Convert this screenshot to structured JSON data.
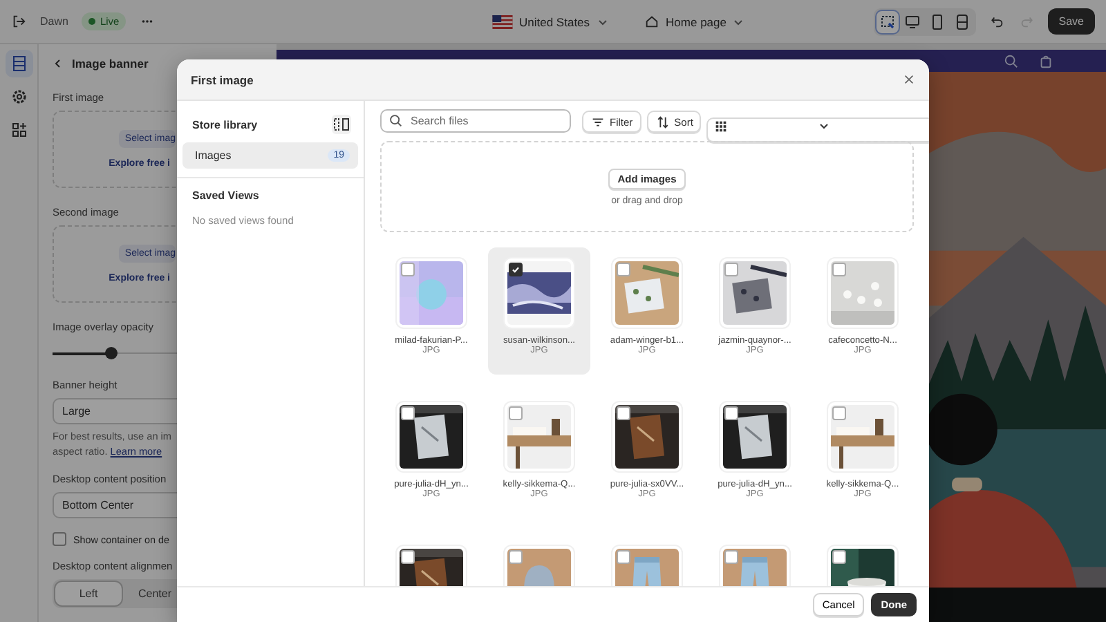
{
  "topbar": {
    "theme": "Dawn",
    "status": "Live",
    "market": "United States",
    "page": "Home page",
    "view_modes": [
      {
        "selected": true
      },
      {
        "selected": false
      },
      {
        "selected": false
      },
      {
        "selected": false
      }
    ],
    "redo": {
      "disabled": true
    },
    "save": "Save"
  },
  "rail": [
    {
      "selected": true
    },
    {
      "selected": false
    },
    {
      "selected": false
    }
  ],
  "settings": {
    "title": "Image banner",
    "fields": [
      {
        "label": "First image",
        "select": "Select imag",
        "explore": "Explore free i"
      },
      {
        "label": "Second image",
        "select": "Select imag",
        "explore": "Explore free i"
      },
      {
        "kind": "slider",
        "label": "Image overlay opacity",
        "level": 0.28
      },
      {
        "kind": "select",
        "label": "Banner height",
        "value": "Large"
      },
      {
        "kind": "help",
        "lines": [
          "For best results, use an im",
          "aspect ratio."
        ],
        "link": "Learn more"
      },
      {
        "kind": "select",
        "label": "Desktop content position",
        "value": "Bottom Center"
      },
      {
        "kind": "checkbox",
        "label": "Show container on de",
        "checked": false
      },
      {
        "kind": "segmented",
        "label": "Desktop content alignmen",
        "options": [
          {
            "label": "Left",
            "selected": true
          },
          {
            "label": "Center",
            "selected": false
          }
        ]
      }
    ]
  },
  "modal": {
    "title": "First image",
    "sidebar": {
      "heading": "Store library",
      "items": [
        {
          "label": "Images",
          "count": "19",
          "selected": true
        }
      ],
      "saved_heading": "Saved Views",
      "saved_empty": "No saved views found"
    },
    "search": {
      "placeholder": "Search files"
    },
    "filter": "Filter",
    "sort": "Sort",
    "upload": {
      "button": "Add images",
      "hint": "or drag and drop"
    },
    "files": [
      {
        "name": "milad-fakurian-P...",
        "type": "JPG",
        "selected": false
      },
      {
        "name": "susan-wilkinson...",
        "type": "JPG",
        "selected": true
      },
      {
        "name": "adam-winger-b1...",
        "type": "JPG",
        "selected": false
      },
      {
        "name": "jazmin-quaynor-...",
        "type": "JPG",
        "selected": false
      },
      {
        "name": "cafeconcetto-N...",
        "type": "JPG",
        "selected": false
      },
      {
        "name": "pure-julia-dH_yn...",
        "type": "JPG",
        "selected": false
      },
      {
        "name": "kelly-sikkema-Q...",
        "type": "JPG",
        "selected": false
      },
      {
        "name": "pure-julia-sx0VV...",
        "type": "JPG",
        "selected": false
      },
      {
        "name": "pure-julia-dH_yn...",
        "type": "JPG",
        "selected": false
      },
      {
        "name": "kelly-sikkema-Q...",
        "type": "JPG",
        "selected": false
      },
      {
        "selected": false
      },
      {
        "selected": false
      },
      {
        "selected": false
      },
      {
        "selected": false
      },
      {
        "selected": false
      }
    ],
    "buttons": {
      "cancel": "Cancel",
      "done": "Done"
    }
  }
}
